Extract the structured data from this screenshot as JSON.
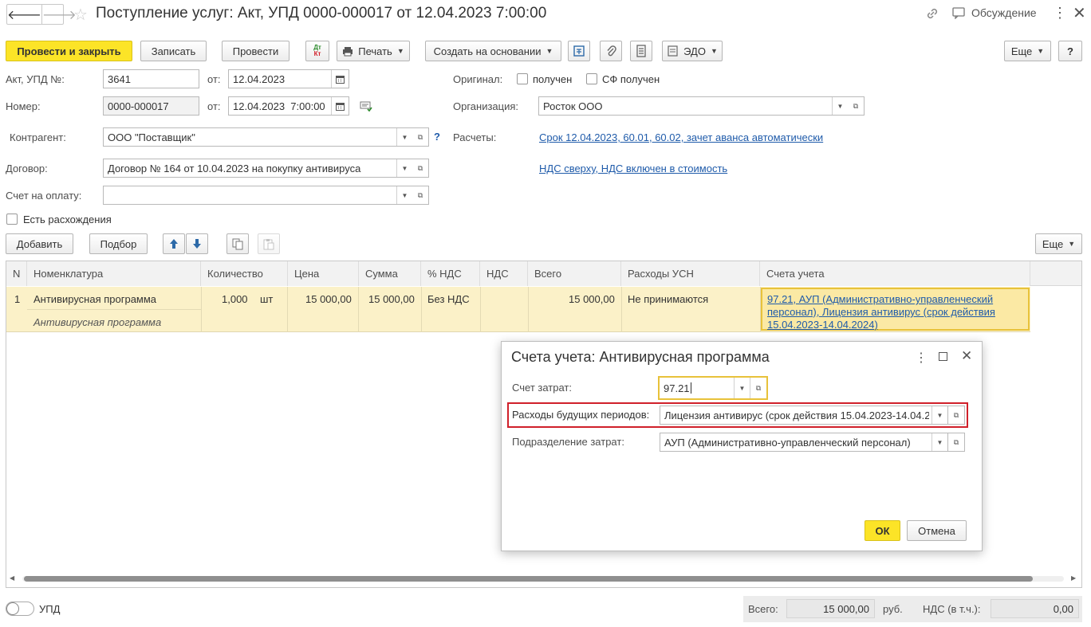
{
  "title": "Поступление услуг: Акт, УПД 0000-000017 от 12.04.2023 7:00:00",
  "header": {
    "discussion": "Обсуждение"
  },
  "toolbar": {
    "post_close": "Провести и закрыть",
    "save": "Записать",
    "post": "Провести",
    "dt_kt_top": "Дт",
    "dt_kt_bottom": "Кт",
    "print": "Печать",
    "create_based": "Создать на основании",
    "edo": "ЭДО",
    "more": "Еще",
    "help": "?"
  },
  "form": {
    "act_label": "Акт, УПД №:",
    "act_value": "3641",
    "from1_label": "от:",
    "from1_value": "12.04.2023",
    "number_label": "Номер:",
    "number_value": "0000-000017",
    "from2_label": "от:",
    "from2_value": "12.04.2023  7:00:00",
    "original_label": "Оригинал:",
    "received": "получен",
    "sf_received": "СФ получен",
    "org_label": "Организация:",
    "org_value": "Росток ООО",
    "contractor_label": "Контрагент:",
    "contractor_value": "ООО \"Поставщик\"",
    "help_q": "?",
    "settlements_label": "Расчеты:",
    "settlements_link": "Срок 12.04.2023, 60.01, 60.02, зачет аванса автоматически",
    "contract_label": "Договор:",
    "contract_value": "Договор № 164 от 10.04.2023 на покупку антивируса",
    "vat_link": "НДС сверху, НДС включен в стоимость",
    "invoice_label": "Счет на оплату:",
    "invoice_value": "",
    "discrepancy": "Есть расхождения"
  },
  "table_toolbar": {
    "add": "Добавить",
    "pick": "Подбор",
    "more": "Еще"
  },
  "table": {
    "headers": [
      "N",
      "Номенклатура",
      "Количество",
      "Цена",
      "Сумма",
      "% НДС",
      "НДС",
      "Всего",
      "Расходы УСН",
      "Счета учета"
    ],
    "row": {
      "n": "1",
      "item": "Антивирусная программа",
      "item_sub": "Антивирусная программа",
      "qty": "1,000",
      "unit": "шт",
      "price": "15 000,00",
      "sum": "15 000,00",
      "vat_rate": "Без НДС",
      "vat": "",
      "total": "15 000,00",
      "usn": "Не принимаются",
      "accounts": "97.21, АУП (Административно-управленческий персонал), Лицензия антивирус (срок действия 15.04.2023-14.04.2024)"
    }
  },
  "dialog": {
    "title": "Счета учета: Антивирусная программа",
    "cost_account_label": "Счет затрат:",
    "cost_account_value": "97.21",
    "future_expenses_label": "Расходы будущих периодов:",
    "future_expenses_value": "Лицензия антивирус (срок действия 15.04.2023-14.04.2024)",
    "cost_dept_label": "Подразделение затрат:",
    "cost_dept_value": "АУП (Административно-управленческий персонал)",
    "ok": "ОК",
    "cancel": "Отмена"
  },
  "footer": {
    "upd": "УПД",
    "total_label": "Всего:",
    "total_value": "15 000,00",
    "currency": "руб.",
    "vat_label": "НДС (в т.ч.):",
    "vat_value": "0,00"
  },
  "colors": {
    "primary_yellow": "#fce427",
    "link_blue": "#1f5baa",
    "highlight_red": "#d0202a",
    "row_selected": "#fbf1c8"
  }
}
